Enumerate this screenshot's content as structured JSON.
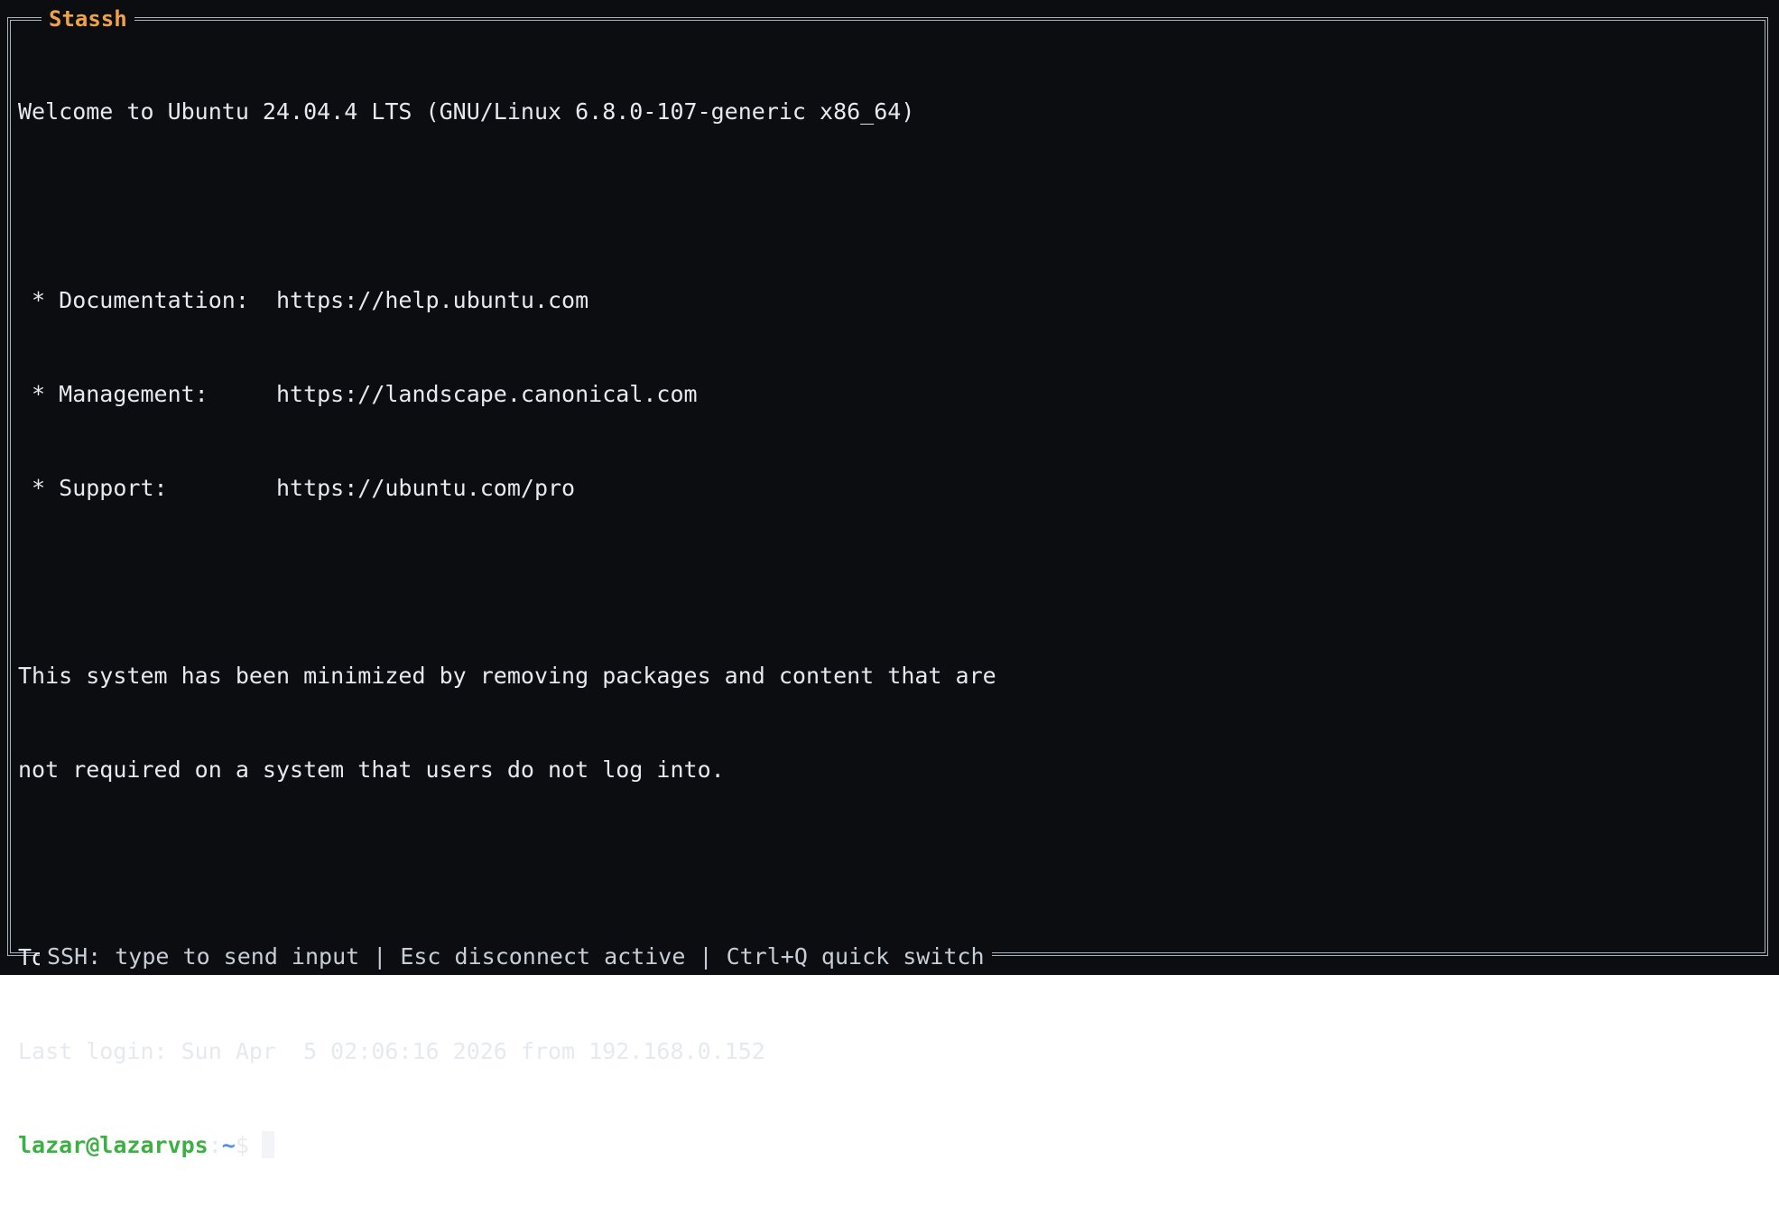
{
  "window": {
    "title": "Stassh"
  },
  "terminal": {
    "lines": [
      "Welcome to Ubuntu 24.04.4 LTS (GNU/Linux 6.8.0-107-generic x86_64)",
      "",
      " * Documentation:  https://help.ubuntu.com",
      " * Management:     https://landscape.canonical.com",
      " * Support:        https://ubuntu.com/pro",
      "",
      "This system has been minimized by removing packages and content that are",
      "not required on a system that users do not log into.",
      "",
      "To restore this content, you can run the 'unminimize' command.",
      "Last login: Sun Apr  5 02:06:16 2026 from 192.168.0.152"
    ],
    "prompt": {
      "user_host": "lazar@lazarvps",
      "separator": ":",
      "path": "~",
      "symbol": "$"
    }
  },
  "status_bar": {
    "text": "SSH: type to send input | Esc disconnect active | Ctrl+Q quick switch"
  },
  "colors": {
    "background": "#0b0d10",
    "frame": "#aab4c0",
    "title": "#f0a24a",
    "prompt_user": "#3cb043",
    "prompt_path": "#4f8fe6",
    "text": "#e6e9ee"
  }
}
